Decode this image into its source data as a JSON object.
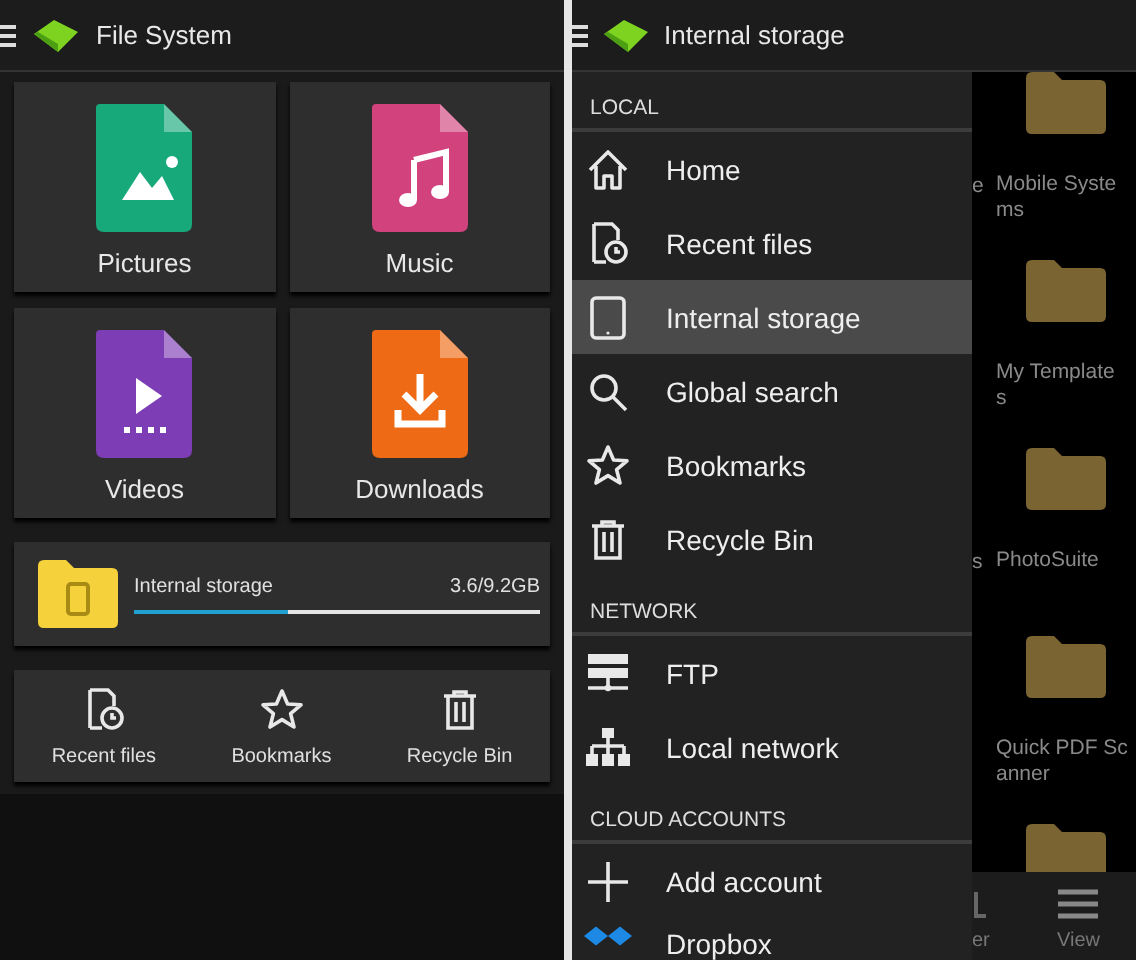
{
  "left_screen": {
    "title": "File System",
    "categories": [
      {
        "label": "Pictures",
        "kind": "pictures",
        "color": "#17a97a"
      },
      {
        "label": "Music",
        "kind": "music",
        "color": "#d2427d"
      },
      {
        "label": "Videos",
        "kind": "videos",
        "color": "#7d3db5"
      },
      {
        "label": "Downloads",
        "kind": "downloads",
        "color": "#ee6a14"
      }
    ],
    "storage": {
      "name": "Internal storage",
      "usage": "3.6/9.2GB",
      "level": 0.38
    },
    "shortcuts": [
      {
        "label": "Recent files",
        "kind": "recent"
      },
      {
        "label": "Bookmarks",
        "kind": "bookmarks"
      },
      {
        "label": "Recycle Bin",
        "kind": "trash"
      }
    ]
  },
  "right_screen": {
    "title": "Internal storage",
    "drawer": {
      "sections": [
        {
          "heading": "LOCAL",
          "items": [
            {
              "label": "Home",
              "kind": "home",
              "selected": false
            },
            {
              "label": "Recent files",
              "kind": "recent",
              "selected": false
            },
            {
              "label": "Internal storage",
              "kind": "tablet",
              "selected": true
            },
            {
              "label": "Global search",
              "kind": "search",
              "selected": false
            },
            {
              "label": "Bookmarks",
              "kind": "bookmarks",
              "selected": false
            },
            {
              "label": "Recycle Bin",
              "kind": "trash",
              "selected": false
            }
          ]
        },
        {
          "heading": "NETWORK",
          "items": [
            {
              "label": "FTP",
              "kind": "ftp",
              "selected": false
            },
            {
              "label": "Local network",
              "kind": "network",
              "selected": false
            }
          ]
        },
        {
          "heading": "CLOUD ACCOUNTS",
          "items": [
            {
              "label": "Add account",
              "kind": "add",
              "selected": false
            },
            {
              "label": "Dropbox",
              "kind": "dropbox",
              "selected": false
            }
          ]
        }
      ]
    },
    "file_grid": {
      "rows": [
        {
          "kind": "folder",
          "column_1": "e",
          "column_2": [
            "Mobile Syste",
            "ms"
          ]
        },
        {
          "kind": "folder",
          "column_2": [
            "My Template",
            "s"
          ]
        },
        {
          "kind": "folder",
          "column_1": "s",
          "column_2": [
            "PhotoSuite"
          ]
        },
        {
          "kind": "folder",
          "column_2": [
            "Quick PDF Sc",
            "anner"
          ]
        },
        {
          "kind": "folder"
        }
      ]
    },
    "bottom_bar": [
      {
        "label": "er",
        "kind": "cut"
      },
      {
        "label": "View",
        "kind": "view"
      }
    ]
  }
}
